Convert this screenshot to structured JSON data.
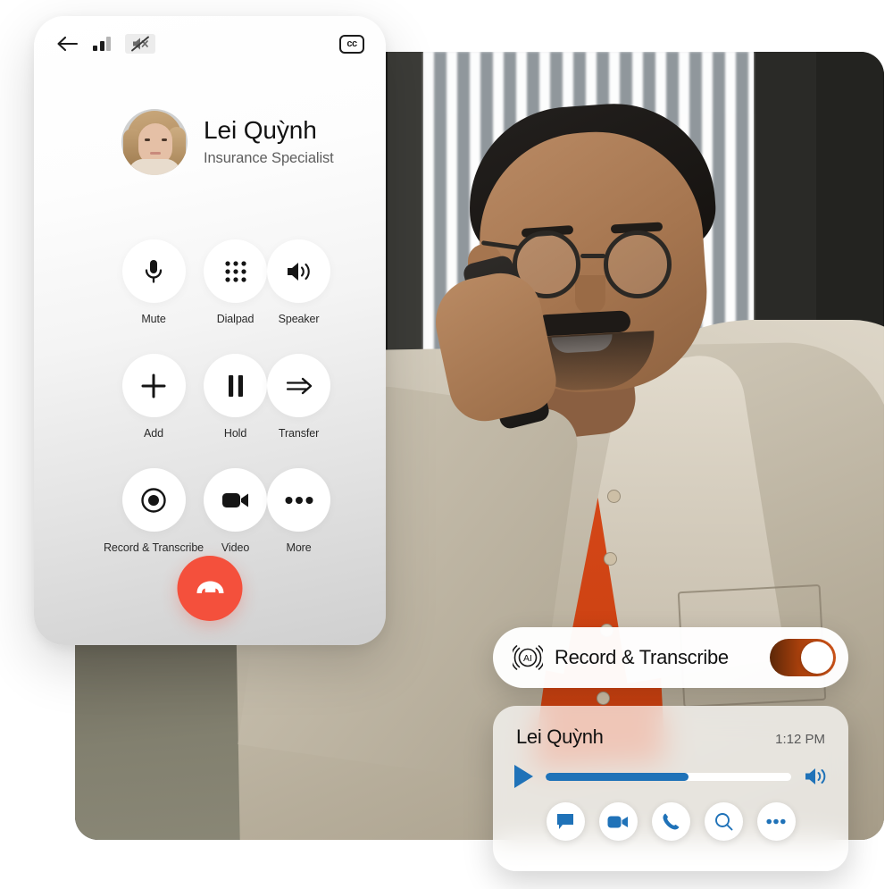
{
  "phone_screen": {
    "statusbar": {
      "back_icon": "back-arrow-icon",
      "signal_icon": "signal-bars-icon",
      "mute_icon": "speaker-muted-icon",
      "cc_label": "cc"
    },
    "caller": {
      "name": "Lei Quỳnh",
      "role": "Insurance Specialist",
      "avatar_icon": "avatar-photo"
    },
    "controls": [
      {
        "label": "Mute",
        "icon": "microphone-icon"
      },
      {
        "label": "Dialpad",
        "icon": "dialpad-icon"
      },
      {
        "label": "Speaker",
        "icon": "speaker-icon"
      },
      {
        "label": "Add",
        "icon": "plus-icon"
      },
      {
        "label": "Hold",
        "icon": "pause-icon"
      },
      {
        "label": "Transfer",
        "icon": "arrow-right-icon"
      },
      {
        "label": "Record & Transcribe",
        "icon": "record-dot-icon"
      },
      {
        "label": "Video",
        "icon": "video-camera-icon"
      },
      {
        "label": "More",
        "icon": "ellipsis-icon"
      }
    ],
    "end_call": {
      "icon": "hangup-phone-icon",
      "color": "#F4503C"
    }
  },
  "record_card": {
    "ai_icon": "ai-badge-icon",
    "label": "Record & Transcribe",
    "toggle_state": "on",
    "toggle_color": "#D4561A"
  },
  "player_card": {
    "name": "Lei Quỳnh",
    "time": "1:12 PM",
    "play_icon": "play-icon",
    "volume_icon": "volume-icon",
    "progress_percent": 58,
    "accent_color": "#1F72B8",
    "actions": [
      {
        "icon": "chat-bubble-icon"
      },
      {
        "icon": "video-camera-icon"
      },
      {
        "icon": "phone-icon"
      },
      {
        "icon": "search-icon"
      },
      {
        "icon": "ellipsis-icon"
      }
    ]
  },
  "photo": {
    "alt": "man-on-phone-call-photo"
  }
}
